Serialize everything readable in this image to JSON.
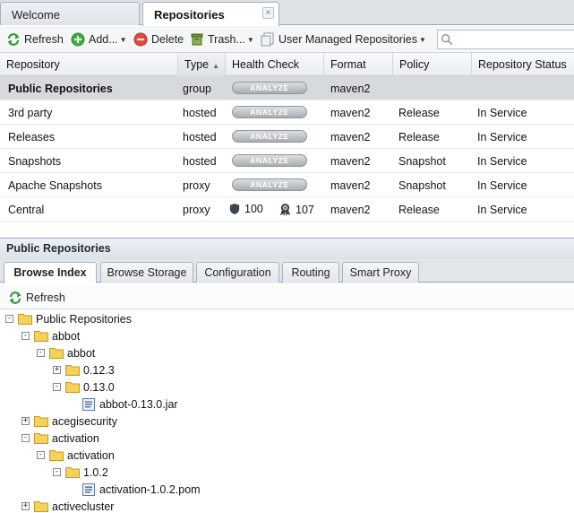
{
  "tabs": {
    "welcome": "Welcome",
    "repositories": "Repositories",
    "close": "×"
  },
  "toolbar": {
    "refresh": "Refresh",
    "add": "Add...",
    "delete": "Delete",
    "trash": "Trash...",
    "user_managed": "User Managed Repositories"
  },
  "search": {
    "placeholder": "",
    "value": ""
  },
  "grid": {
    "columns": [
      "Repository",
      "Type",
      "Health Check",
      "Format",
      "Policy",
      "Repository Status"
    ],
    "sorted_column": "Type",
    "analyze_label": "ANALYZE",
    "rows": [
      {
        "name": "Public Repositories",
        "type": "group",
        "health": "analyze",
        "format": "maven2",
        "policy": "",
        "status": "",
        "selected": true
      },
      {
        "name": "3rd party",
        "type": "hosted",
        "health": "analyze",
        "format": "maven2",
        "policy": "Release",
        "status": "In Service"
      },
      {
        "name": "Releases",
        "type": "hosted",
        "health": "analyze",
        "format": "maven2",
        "policy": "Release",
        "status": "In Service"
      },
      {
        "name": "Snapshots",
        "type": "hosted",
        "health": "analyze",
        "format": "maven2",
        "policy": "Snapshot",
        "status": "In Service"
      },
      {
        "name": "Apache Snapshots",
        "type": "proxy",
        "health": "analyze",
        "format": "maven2",
        "policy": "Snapshot",
        "status": "In Service"
      },
      {
        "name": "Central",
        "type": "proxy",
        "health": "scores",
        "security_count": "100",
        "license_count": "107",
        "format": "maven2",
        "policy": "Release",
        "status": "In Service"
      }
    ]
  },
  "panel": {
    "title": "Public Repositories",
    "tabs": [
      "Browse Index",
      "Browse Storage",
      "Configuration",
      "Routing",
      "Smart Proxy"
    ],
    "refresh": "Refresh",
    "tree": [
      {
        "label": "Public Repositories",
        "kind": "folder",
        "toggle": "-"
      },
      {
        "label": "abbot",
        "kind": "folder",
        "toggle": "-"
      },
      {
        "label": "abbot",
        "kind": "folder",
        "toggle": "-"
      },
      {
        "label": "0.12.3",
        "kind": "folder",
        "toggle": "+"
      },
      {
        "label": "0.13.0",
        "kind": "folder",
        "toggle": "-"
      },
      {
        "label": "abbot-0.13.0.jar",
        "kind": "file",
        "toggle": ""
      },
      {
        "label": "acegisecurity",
        "kind": "folder",
        "toggle": "+"
      },
      {
        "label": "activation",
        "kind": "folder",
        "toggle": "-"
      },
      {
        "label": "activation",
        "kind": "folder",
        "toggle": "-"
      },
      {
        "label": "1.0.2",
        "kind": "folder",
        "toggle": "-"
      },
      {
        "label": "activation-1.0.2.pom",
        "kind": "file",
        "toggle": ""
      },
      {
        "label": "activecluster",
        "kind": "folder",
        "toggle": "+"
      }
    ]
  },
  "colors": {
    "accent": "#2f7ed8",
    "selected_row": "#d7dadd",
    "folder": "#f2c94c"
  },
  "icons": {
    "refresh": "refresh-icon",
    "add": "add-icon",
    "delete": "delete-icon",
    "trash": "trash-icon",
    "user_managed": "repository-icon",
    "search": "search-icon",
    "security": "shield-icon",
    "license": "ribbon-icon",
    "folder": "folder-icon",
    "file": "file-icon"
  }
}
